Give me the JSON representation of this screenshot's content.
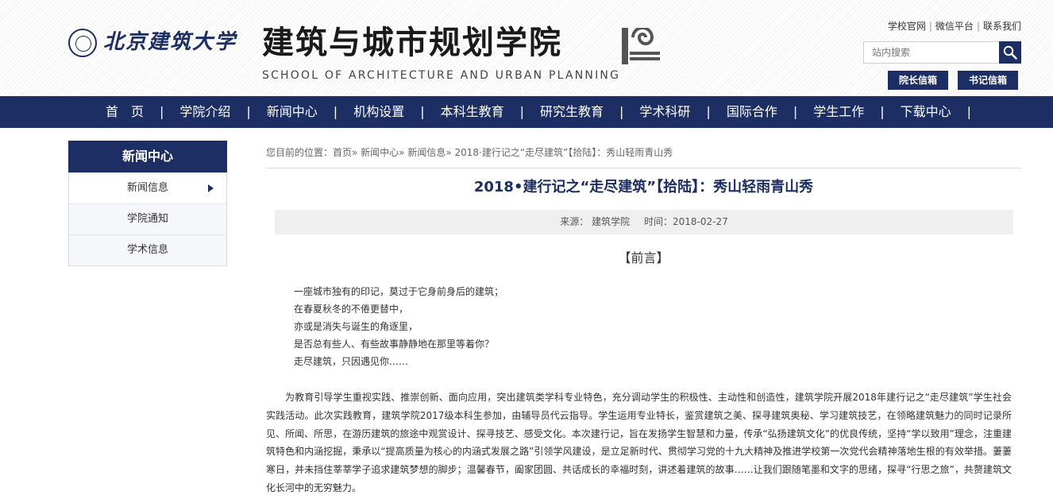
{
  "header": {
    "university_name": "北京建筑大学",
    "school_name_cn": "建筑与城市规划学院",
    "school_name_en": "SCHOOL OF ARCHITECTURE AND URBAN PLANNING",
    "links": [
      "学校官网",
      "微信平台",
      "联系我们"
    ],
    "search_placeholder": "站内搜索",
    "mail_buttons": [
      "院长信箱",
      "书记信箱"
    ],
    "brand_color": "#1c2e63"
  },
  "nav": {
    "items": [
      "首　页",
      "学院介绍",
      "新闻中心",
      "机构设置",
      "本科生教育",
      "研究生教育",
      "学术科研",
      "国际合作",
      "学生工作",
      "下载中心"
    ]
  },
  "sidebar": {
    "title": "新闻中心",
    "items": [
      {
        "label": "新闻信息",
        "active": true
      },
      {
        "label": "学院通知",
        "active": false
      },
      {
        "label": "学术信息",
        "active": false
      }
    ]
  },
  "breadcrumb": {
    "prefix": "您目前的位置：",
    "path": "首页» 新闻中心» 新闻信息» 2018·建行记之“走尽建筑”【拾陆】：秀山轻雨青山秀"
  },
  "article": {
    "title": "2018•建行记之“走尽建筑”【拾陆】：秀山轻雨青山秀",
    "source_label": "来源：",
    "source": "建筑学院",
    "time_label": "时间：",
    "time": "2018-02-27",
    "preface": "【前言】",
    "poem": [
      "一座城市独有的印记，莫过于它身前身后的建筑；",
      "在春夏秋冬的不倦更替中，",
      "亦或是消失与诞生的角逐里，",
      "是否总有些人、有些故事静静地在那里等着你？",
      "走尽建筑，只因遇见你……"
    ],
    "paragraph": "为教育引导学生重视实践、推崇创新、面向应用，突出建筑类学科专业特色，充分调动学生的积极性、主动性和创造性，建筑学院开展2018年建行记之“走尽建筑”学生社会实践活动。此次实践教育，建筑学院2017级本科生参加，由辅导员代云指导。学生运用专业特长，鉴赏建筑之美、探寻建筑奥秘、学习建筑技艺，在领略建筑魅力的同时记录所见、所闻、所思，在游历建筑的旅途中观赏设计、探寻技艺、感受文化。本次建行记，旨在发扬学生智慧和力量，传承“弘扬建筑文化”的优良传统，坚持“学以致用”理念，注重建筑特色和内涵挖掘，秉承以“提高质量为核心的内涵式发展之路”引领学风建设，是立足新时代、贯彻学习党的十九大精神及推进学校第一次党代会精神落地生根的有效举措。萋萋寒日，并未挡住莘莘学子追求建筑梦想的脚步；温馨春节，阖家团圆、共话成长的幸福时刻，讲述着建筑的故事……让我们跟随笔墨和文字的思绪，探寻“行思之旅”，共赘建筑文化长河中的无穷魅力。"
  }
}
